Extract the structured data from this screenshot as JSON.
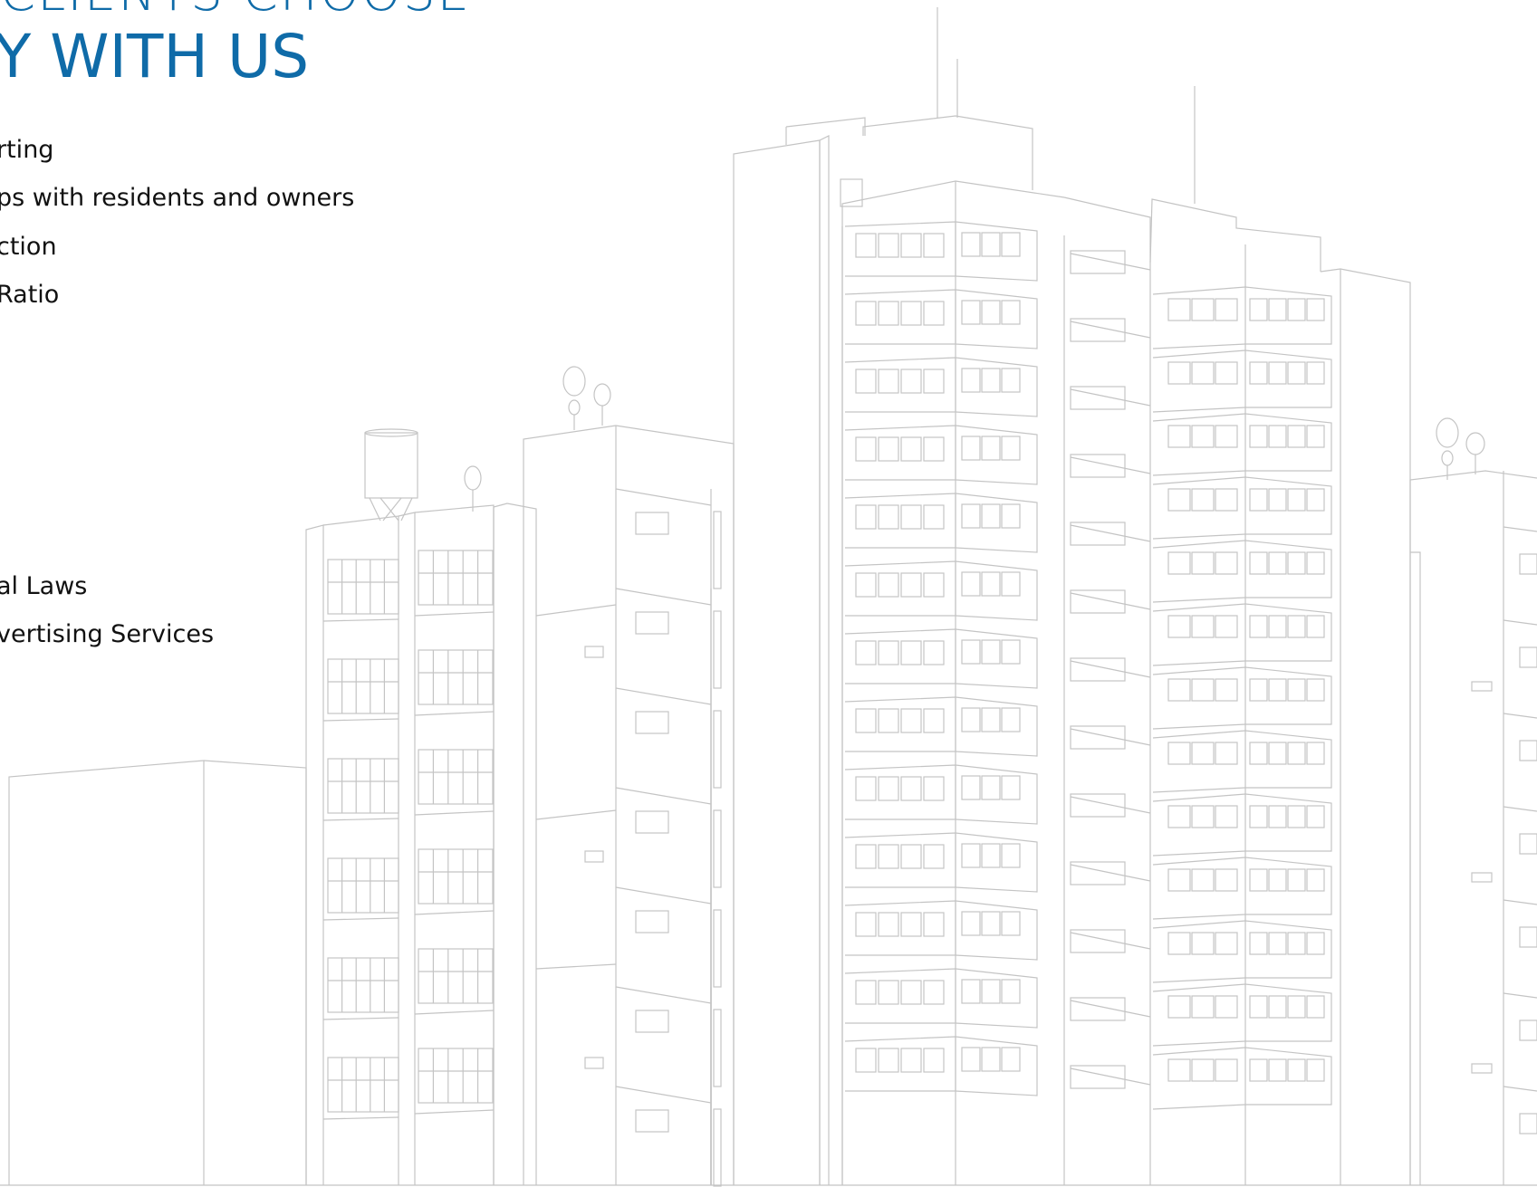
{
  "heading": {
    "line1": "CLIENTS CHOOSE",
    "line2": "Y WITH US"
  },
  "benefits": {
    "items": [
      "rting",
      "ps with residents and owners",
      "ction",
      "Ratio",
      "al Laws",
      "vertising Services"
    ]
  },
  "colors": {
    "accent": "#0f6ba8",
    "text": "#111111",
    "line": "#c4c4c4"
  }
}
